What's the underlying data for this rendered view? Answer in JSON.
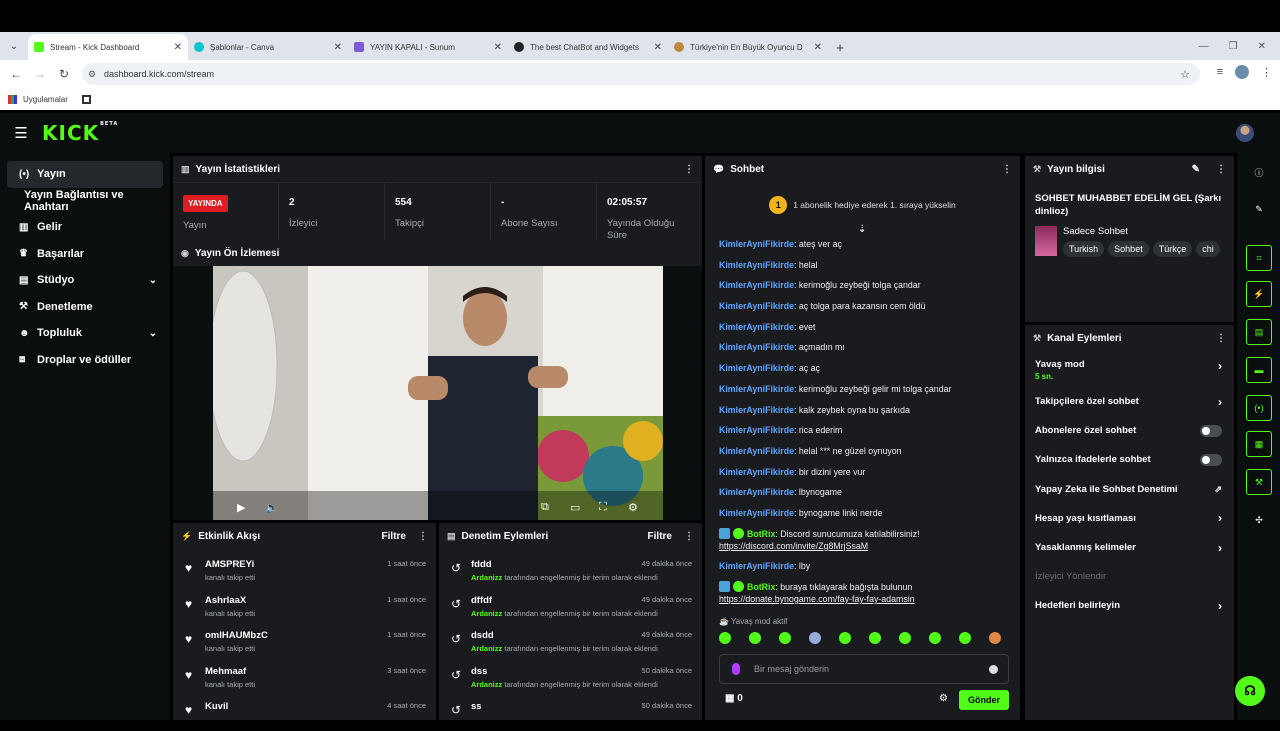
{
  "browser": {
    "tabs": [
      {
        "title": "Stream - Kick Dashboard",
        "color": "#53fc18"
      },
      {
        "title": "Şablonlar - Canva",
        "color": "#00c4cc"
      },
      {
        "title": "YAYIN KAPALI - Sunum",
        "color": "#4285f4"
      },
      {
        "title": "The best ChatBot and Widgets",
        "color": "#222222"
      },
      {
        "title": "Türkiye'nin En Büyük Oyuncu D",
        "color": "#c08a3e"
      }
    ],
    "url": "dashboard.kick.com/stream",
    "bookmark": "Uygulamalar"
  },
  "kick": {
    "logo": "KICK",
    "beta": "BETA"
  },
  "sidebar": {
    "items": [
      {
        "label": "Yayın",
        "icon": "broadcast-icon"
      },
      {
        "label": "Yayın Bağlantısı ve Anahtarı",
        "icon": ""
      },
      {
        "label": "Gelir",
        "icon": "chart-icon"
      },
      {
        "label": "Başarılar",
        "icon": "trophy-icon"
      },
      {
        "label": "Stüdyo",
        "icon": "studio-icon"
      },
      {
        "label": "Denetleme",
        "icon": "wrench-icon"
      },
      {
        "label": "Topluluk",
        "icon": "people-icon"
      },
      {
        "label": "Droplar ve ödüller",
        "icon": "gift-icon"
      }
    ]
  },
  "stats": {
    "title": "Yayın İstatistikleri",
    "live": "YAYINDA",
    "live_label": "Yayın",
    "items": [
      {
        "value": "2",
        "label": "İzleyici"
      },
      {
        "value": "554",
        "label": "Takipçi"
      },
      {
        "value": "-",
        "label": "Abone Sayısı"
      },
      {
        "value": "02:05:57",
        "label": "Yayında Olduğu Süre"
      }
    ]
  },
  "preview": {
    "title": "Yayın Ön İzlemesi"
  },
  "activity": {
    "title": "Etkinlik Akışı",
    "filter": "Filtre",
    "rows": [
      {
        "name": "AMSPREYi",
        "sub": "kanalı takip etti",
        "time": "1 saat önce"
      },
      {
        "name": "AshrlaaX",
        "sub": "kanalı takip etti",
        "time": "1 saat önce"
      },
      {
        "name": "omIHAUMbzC",
        "sub": "kanalı takip etti",
        "time": "1 saat önce"
      },
      {
        "name": "Mehmaaf",
        "sub": "kanalı takip etti",
        "time": "3 saat önce"
      },
      {
        "name": "Kuvil",
        "sub": "",
        "time": "4 saat önce"
      }
    ]
  },
  "moderation": {
    "title": "Denetim Eylemleri",
    "filter": "Filtre",
    "actor": "Ardanizz",
    "desc": "tarafından engellenmiş bir terim olarak eklendi",
    "rows": [
      {
        "term": "fddd",
        "time": "49 dakika önce"
      },
      {
        "term": "dffdf",
        "time": "49 dakika önce"
      },
      {
        "term": "dsdd",
        "time": "49 dakika önce"
      },
      {
        "term": "dss",
        "time": "50 dakika önce"
      },
      {
        "term": "ss",
        "time": "50 dakika önce"
      }
    ]
  },
  "chat": {
    "title": "Sohbet",
    "pin": "1 abonelik hediye ederek 1. sıraya yükselin",
    "pin_num": "1",
    "user": "KimlerAyniFikirde",
    "messages": [
      "ateş ver aç",
      "helal",
      "kerimoğlu zeybeği tolga çandar",
      "aç tolga para kazansın cem öldü",
      "evet",
      "açmadın mı",
      "aç aç",
      "kerimoğlu zeybeği gelir mi tolga çandar",
      "kalk zeybek oyna bu şarkıda",
      "rica ederim",
      "helal *** ne güzel oynuyon",
      "bir dizini yere vur",
      "lbynogame",
      "bynogame linki nerde"
    ],
    "bot": "BotRix",
    "bot_msg1": "Discord sunucumuza katılabilirsiniz!",
    "bot_link1": "https://discord.com/invite/Zg8MrjSsaM",
    "lby": "lby",
    "bot_msg2": "buraya tıklayarak bağışta bulunun",
    "bot_link2": "https://donate.bynogame.com/fay-fay-fay-adamsin",
    "slow": "Yavaş mod aktif",
    "placeholder": "Bir mesaj gönderin",
    "points": "0",
    "send": "Gönder"
  },
  "info": {
    "title": "Yayın bilgisi",
    "stream_title": "SOHBET MUHABBET EDELİM GEL (Şarkı dinlioz)",
    "category": "Sadece Sohbet",
    "tags": [
      "Turkish",
      "Sohbet",
      "Türkçe",
      "chi"
    ]
  },
  "actions": {
    "title": "Kanal Eylemleri",
    "slow_mode": "Yavaş mod",
    "slow_value": "5 sn.",
    "followers": "Takipçilere özel sohbet",
    "subs": "Abonelere özel sohbet",
    "emotes": "Yalnızca ifadelerle sohbet",
    "ai": "Yapay Zeka ile Sohbet Denetimi",
    "age": "Hesap yaşı kısıtlaması",
    "banned": "Yasaklanmış kelimeler",
    "viewer": "İzleyici Yönlendir",
    "goals": "Hedefleri belirleyin"
  }
}
